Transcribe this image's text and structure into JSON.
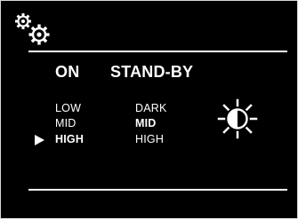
{
  "colors": {
    "background": "#000000",
    "text": "#ffffff"
  },
  "header": {
    "icon": "settings-gears-icon"
  },
  "columns": {
    "on": {
      "title": "ON"
    },
    "standby": {
      "title": "STAND-BY"
    }
  },
  "on_levels": {
    "items": [
      "LOW",
      "MID",
      "HIGH"
    ],
    "selected": "HIGH"
  },
  "standby_levels": {
    "items": [
      "DARK",
      "MID",
      "HIGH"
    ],
    "selected": "MID"
  },
  "side_icon": "brightness-icon",
  "pointer_icon": "selection-pointer-icon"
}
